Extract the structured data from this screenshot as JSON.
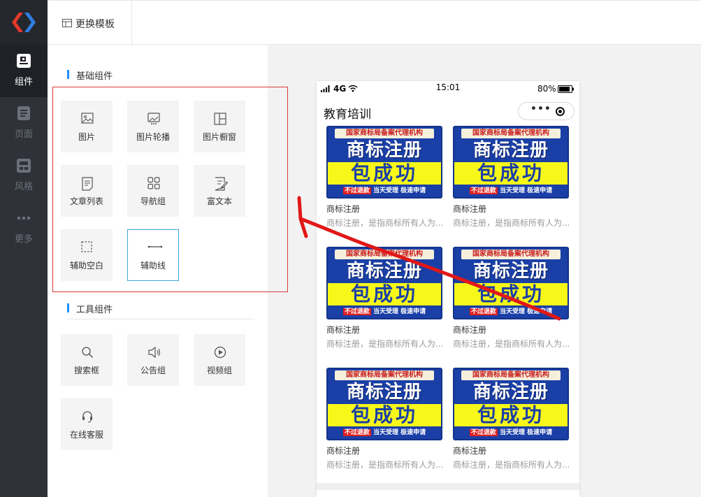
{
  "nav": {
    "items": [
      {
        "label": "组件",
        "icon": "component-icon",
        "active": true
      },
      {
        "label": "页面",
        "icon": "page-icon",
        "active": false
      },
      {
        "label": "风格",
        "icon": "style-icon",
        "active": false
      },
      {
        "label": "更多",
        "icon": "more-icon",
        "active": false
      }
    ]
  },
  "topbar": {
    "template_button": "更换模板"
  },
  "panel": {
    "basic_title": "基础组件",
    "basic_items": [
      {
        "label": "图片",
        "icon": "image-icon"
      },
      {
        "label": "图片轮播",
        "icon": "carousel-icon"
      },
      {
        "label": "图片橱窗",
        "icon": "showcase-icon"
      },
      {
        "label": "文章列表",
        "icon": "article-list-icon"
      },
      {
        "label": "导航组",
        "icon": "nav-group-icon"
      },
      {
        "label": "富文本",
        "icon": "rich-text-icon"
      },
      {
        "label": "辅助空白",
        "icon": "blank-icon"
      },
      {
        "label": "辅助线",
        "icon": "divider-icon",
        "selected": true
      }
    ],
    "tool_title": "工具组件",
    "tool_items": [
      {
        "label": "搜索框",
        "icon": "search-icon"
      },
      {
        "label": "公告组",
        "icon": "announcement-icon"
      },
      {
        "label": "视频组",
        "icon": "video-icon"
      },
      {
        "label": "在线客服",
        "icon": "headset-icon"
      }
    ]
  },
  "phone": {
    "signal": "4G",
    "time": "15:01",
    "battery": "80%",
    "title": "教育培训",
    "capsule_dots": "•••",
    "cards": [
      {
        "banner_top": "国家商标局备案代理机构",
        "banner_main": "商标注册",
        "banner_yellow": "包成功",
        "banner_bottom_1": "不过退款",
        "banner_bottom_2": "当天受理",
        "banner_bottom_3": "极速申请",
        "name": "商标注册",
        "desc": "商标注册，是指商标所有人为..."
      },
      {
        "banner_top": "国家商标局备案代理机构",
        "banner_main": "商标注册",
        "banner_yellow": "包成功",
        "banner_bottom_1": "不过退款",
        "banner_bottom_2": "当天受理",
        "banner_bottom_3": "极速申请",
        "name": "商标注册",
        "desc": "商标注册，是指商标所有人为..."
      },
      {
        "banner_top": "国家商标局备案代理机构",
        "banner_main": "商标注册",
        "banner_yellow": "包成功",
        "banner_bottom_1": "不过退款",
        "banner_bottom_2": "当天受理",
        "banner_bottom_3": "极速申请",
        "name": "商标注册",
        "desc": "商标注册，是指商标所有人为..."
      },
      {
        "banner_top": "国家商标局备案代理机构",
        "banner_main": "商标注册",
        "banner_yellow": "包成功",
        "banner_bottom_1": "不过退款",
        "banner_bottom_2": "当天受理",
        "banner_bottom_3": "极速申请",
        "name": "商标注册",
        "desc": "商标注册，是指商标所有人为..."
      },
      {
        "banner_top": "国家商标局备案代理机构",
        "banner_main": "商标注册",
        "banner_yellow": "包成功",
        "banner_bottom_1": "不过退款",
        "banner_bottom_2": "当天受理",
        "banner_bottom_3": "极速申请",
        "name": "商标注册",
        "desc": "商标注册，是指商标所有人为..."
      },
      {
        "banner_top": "国家商标局备案代理机构",
        "banner_main": "商标注册",
        "banner_yellow": "包成功",
        "banner_bottom_1": "不过退款",
        "banner_bottom_2": "当天受理",
        "banner_bottom_3": "极速申请",
        "name": "商标注册",
        "desc": "商标注册，是指商标所有人为..."
      }
    ]
  },
  "colors": {
    "accent": "#1e90ff",
    "annotation": "#d93a3a",
    "nav_bg": "#2f3339"
  }
}
